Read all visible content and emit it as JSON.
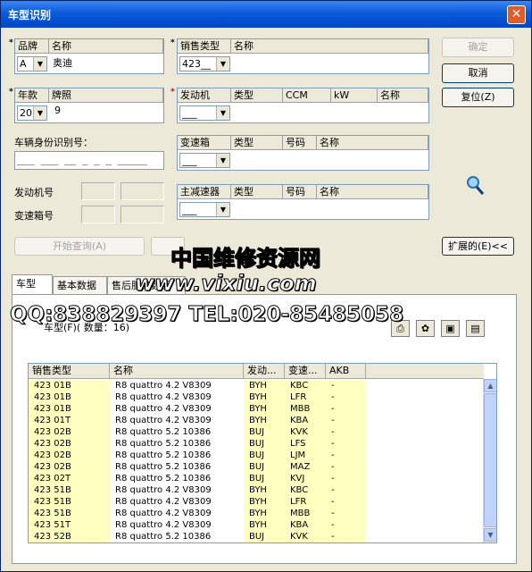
{
  "window": {
    "title": "车型识别",
    "close_glyph": "✕"
  },
  "brand": {
    "col_brand": "品牌",
    "col_name": "名称",
    "value_code": "A",
    "value_name": "奥迪"
  },
  "sales_type": {
    "col_code": "销售类型",
    "col_name": "名称",
    "value_code": "423__"
  },
  "year": {
    "col_year": "年款",
    "col_plate": "牌照",
    "value_year": "20",
    "value_plate": "9"
  },
  "engine": {
    "col_engine": "发动机",
    "col_type": "类型",
    "col_ccm": "CCM",
    "col_kw": "kW",
    "col_name": "名称",
    "value_code": "___"
  },
  "vin": {
    "label": "车辆身份识别号：",
    "value": "___ ___ __ _ _ _ _____"
  },
  "gearbox": {
    "col_gearbox": "变速箱",
    "col_type": "类型",
    "col_number": "号码",
    "col_name": "名称",
    "value_code": "___"
  },
  "engine_no": {
    "label": "发动机号"
  },
  "gearbox_no": {
    "label": "变速箱号"
  },
  "final_drive": {
    "col_final": "主减速器",
    "col_type": "类型",
    "col_number": "号码",
    "col_name": "名称",
    "value_code": "___"
  },
  "buttons": {
    "confirm": "确定",
    "cancel": "取消",
    "reset": "复位(Z)",
    "start_query": "开始查询(A)",
    "expand": "扩展的(E)<<"
  },
  "watermark": {
    "line1": "中国维修资源网",
    "line2": "www.vixiu.com",
    "line3": "QQ:838829397 TEL:020-85485058"
  },
  "tabs": [
    {
      "label": "车型"
    },
    {
      "label": "基本数据"
    },
    {
      "label": "售后服务数据"
    }
  ],
  "vehicle_panel": {
    "caption": "车型(F)( 数量：16)"
  },
  "grid": {
    "columns": [
      "销售类型",
      "名称",
      "发动...",
      "变速...",
      "AKB"
    ],
    "rows": [
      [
        "423 01B",
        "R8 quattro 4.2 V8309",
        "BYH",
        "KBC",
        "-"
      ],
      [
        "423 01B",
        "R8 quattro 4.2 V8309",
        "BYH",
        "LFR",
        "-"
      ],
      [
        "423 01B",
        "R8 quattro 4.2 V8309",
        "BYH",
        "MBB",
        "-"
      ],
      [
        "423 01T",
        "R8 quattro 4.2 V8309",
        "BYH",
        "KBA",
        "-"
      ],
      [
        "423 02B",
        "R8 quattro 5.2 10386",
        "BUJ",
        "KVK",
        "-"
      ],
      [
        "423 02B",
        "R8 quattro 5.2 10386",
        "BUJ",
        "LFS",
        "-"
      ],
      [
        "423 02B",
        "R8 quattro 5.2 10386",
        "BUJ",
        "LJM",
        "-"
      ],
      [
        "423 02B",
        "R8 quattro 5.2 10386",
        "BUJ",
        "MAZ",
        "-"
      ],
      [
        "423 02T",
        "R8 quattro 5.2 10386",
        "BUJ",
        "KVJ",
        "-"
      ],
      [
        "423 51B",
        "R8 quattro 4.2 V8309",
        "BYH",
        "KBC",
        "-"
      ],
      [
        "423 51B",
        "R8 quattro 4.2 V8309",
        "BYH",
        "LFR",
        "-"
      ],
      [
        "423 51B",
        "R8 quattro 4.2 V8309",
        "BYH",
        "MBB",
        "-"
      ],
      [
        "423 51T",
        "R8 quattro 4.2 V8309",
        "BYH",
        "KBA",
        "-"
      ],
      [
        "423 52B",
        "R8 quattro 5.2 10386",
        "BUJ",
        "KVK",
        "-"
      ]
    ]
  }
}
